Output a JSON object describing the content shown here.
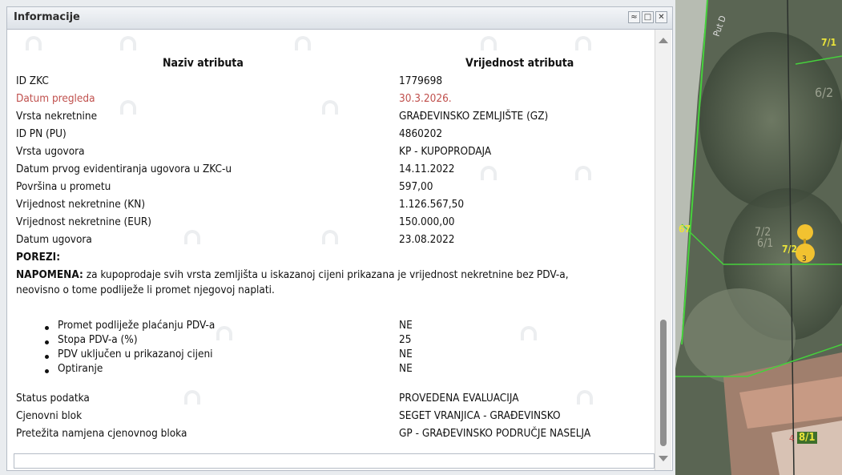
{
  "panel": {
    "title": "Informacije",
    "buttons": {
      "collapse": "≈",
      "maximize": "□",
      "close": "✕"
    }
  },
  "table": {
    "header_name": "Naziv atributa",
    "header_value": "Vrijednost atributa",
    "rows": [
      {
        "name": "ID ZKC",
        "value": "1779698"
      },
      {
        "name": "Datum pregleda",
        "value": "30.3.2026."
      },
      {
        "name": "Vrsta nekretnine",
        "value": "GRAĐEVINSKO ZEMLJIŠTE (GZ)"
      },
      {
        "name": "ID PN (PU)",
        "value": "4860202"
      },
      {
        "name": "Vrsta ugovora",
        "value": "KP - KUPOPRODAJA"
      },
      {
        "name": "Datum prvog evidentiranja ugovora u ZKC-u",
        "value": "14.11.2022"
      },
      {
        "name": "Površina u prometu",
        "value": "597,00"
      },
      {
        "name": "Vrijednost nekretnine (KN)",
        "value": "1.126.567,50"
      },
      {
        "name": "Vrijednost nekretnine (EUR)",
        "value": "150.000,00"
      },
      {
        "name": "Datum ugovora",
        "value": "23.08.2022"
      }
    ],
    "highlight_color": "#c0504d"
  },
  "porezi": {
    "label": "POREZI:",
    "note_label": "NAPOMENA:",
    "note_text_1": " za kupoprodaje svih vrsta zemljišta u iskazanoj cijeni prikazana je vrijednost nekretnine bez PDV-a,",
    "note_text_2": "neovisno o tome podliježe li promet njegovoj naplati.",
    "items": [
      {
        "name": "Promet podliježe plaćanju PDV-a",
        "value": "NE"
      },
      {
        "name": "Stopa PDV-a (%)",
        "value": "25"
      },
      {
        "name": "PDV uključen u prikazanoj cijeni",
        "value": "NE"
      },
      {
        "name": "Optiranje",
        "value": "NE"
      }
    ]
  },
  "footer_rows": [
    {
      "name": "Status podatka",
      "value": "PROVEDENA EVALUACIJA"
    },
    {
      "name": "Cjenovni blok",
      "value": "SEGET VRANJICA - GRAĐEVINSKO"
    },
    {
      "name": "Pretežita namjena cjenovnog bloka",
      "value": "GP - GRAĐEVINSKO PODRUČJE NASELJA"
    }
  ],
  "map": {
    "labels": {
      "road": "Put D",
      "p71": "7/1",
      "p62": "6/2",
      "p67": "67",
      "p72a": "7/2",
      "p61": "6/1",
      "p72": "7/2",
      "pin_num": "3",
      "p4": "4",
      "p81": "8/1"
    },
    "colors": {
      "parcel_line": "#46d13c",
      "label_yellow": "#e9e33a",
      "pin": "#f2c230"
    }
  }
}
